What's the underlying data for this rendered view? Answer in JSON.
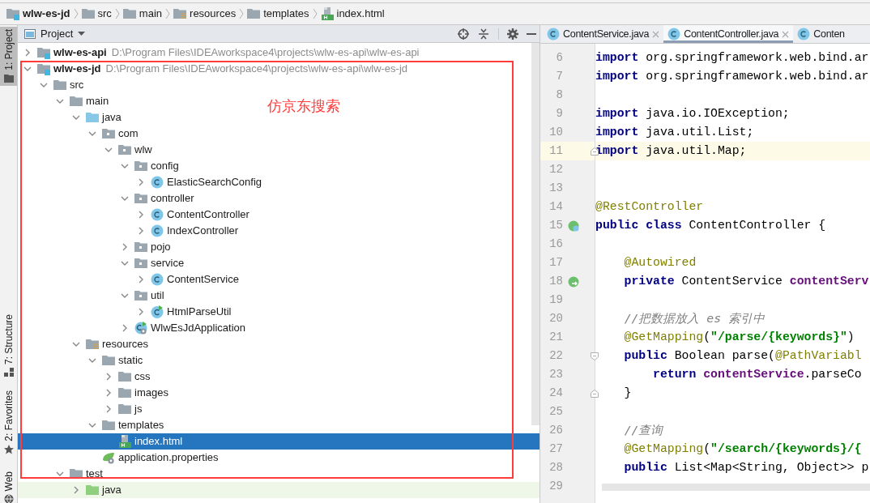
{
  "breadcrumb": [
    {
      "label": "wlw-es-jd",
      "kind": "module"
    },
    {
      "label": "src",
      "kind": "folder"
    },
    {
      "label": "main",
      "kind": "folder"
    },
    {
      "label": "resources",
      "kind": "resources"
    },
    {
      "label": "templates",
      "kind": "folder"
    },
    {
      "label": "index.html",
      "kind": "html"
    }
  ],
  "tool_strip": [
    {
      "label": "1: Project",
      "kind": "project",
      "selected": true
    },
    {
      "label": "7: Structure",
      "kind": "structure",
      "selected": false
    },
    {
      "label": "2: Favorites",
      "kind": "favorites",
      "selected": false
    },
    {
      "label": "Web",
      "kind": "web",
      "selected": false
    }
  ],
  "project_panel": {
    "title": "Project",
    "annotation": {
      "label": "仿京东搜索"
    },
    "tree": [
      {
        "label": "wlw-es-api",
        "kind": "module",
        "path": "D:\\Program Files\\IDEAworkspace4\\projects\\wlw-es-api\\wlw-es-api",
        "expanded": false,
        "selected": false
      },
      {
        "label": "wlw-es-jd",
        "kind": "module",
        "path": "D:\\Program Files\\IDEAworkspace4\\projects\\wlw-es-api\\wlw-es-jd",
        "expanded": true,
        "selected": false,
        "children": [
          {
            "label": "src",
            "kind": "folder",
            "expanded": true,
            "selected": false,
            "children": [
              {
                "label": "main",
                "kind": "folder",
                "expanded": true,
                "selected": false,
                "children": [
                  {
                    "label": "java",
                    "kind": "source-folder",
                    "expanded": true,
                    "selected": false,
                    "children": [
                      {
                        "label": "com",
                        "kind": "package",
                        "expanded": true,
                        "selected": false,
                        "children": [
                          {
                            "label": "wlw",
                            "kind": "package",
                            "expanded": true,
                            "selected": false,
                            "children": [
                              {
                                "label": "config",
                                "kind": "package",
                                "expanded": true,
                                "selected": false,
                                "children": [
                                  {
                                    "label": "ElasticSearchConfig",
                                    "kind": "class",
                                    "expanded": false,
                                    "selected": false
                                  }
                                ]
                              },
                              {
                                "label": "controller",
                                "kind": "package",
                                "expanded": true,
                                "selected": false,
                                "children": [
                                  {
                                    "label": "ContentController",
                                    "kind": "class",
                                    "expanded": false,
                                    "selected": false
                                  },
                                  {
                                    "label": "IndexController",
                                    "kind": "class",
                                    "expanded": false,
                                    "selected": false
                                  }
                                ]
                              },
                              {
                                "label": "pojo",
                                "kind": "package",
                                "expanded": false,
                                "selected": false
                              },
                              {
                                "label": "service",
                                "kind": "package",
                                "expanded": true,
                                "selected": false,
                                "children": [
                                  {
                                    "label": "ContentService",
                                    "kind": "class",
                                    "expanded": false,
                                    "selected": false
                                  }
                                ]
                              },
                              {
                                "label": "util",
                                "kind": "package",
                                "expanded": true,
                                "selected": false,
                                "children": [
                                  {
                                    "label": "HtmlParseUtil",
                                    "kind": "runnable-class",
                                    "expanded": false,
                                    "selected": false
                                  }
                                ]
                              },
                              {
                                "label": "WlwEsJdApplication",
                                "kind": "spring-class",
                                "expanded": false,
                                "selected": false
                              }
                            ]
                          }
                        ]
                      }
                    ]
                  },
                  {
                    "label": "resources",
                    "kind": "resources",
                    "expanded": true,
                    "selected": false,
                    "children": [
                      {
                        "label": "static",
                        "kind": "folder",
                        "expanded": true,
                        "selected": false,
                        "children": [
                          {
                            "label": "css",
                            "kind": "folder",
                            "expanded": false,
                            "selected": false
                          },
                          {
                            "label": "images",
                            "kind": "folder",
                            "expanded": false,
                            "selected": false
                          },
                          {
                            "label": "js",
                            "kind": "folder",
                            "expanded": false,
                            "selected": false
                          }
                        ]
                      },
                      {
                        "label": "templates",
                        "kind": "folder",
                        "expanded": true,
                        "selected": false,
                        "children": [
                          {
                            "label": "index.html",
                            "kind": "html",
                            "selected": true
                          }
                        ]
                      },
                      {
                        "label": "application.properties",
                        "kind": "properties",
                        "selected": false
                      }
                    ]
                  }
                ]
              },
              {
                "label": "test",
                "kind": "folder",
                "expanded": true,
                "selected": false,
                "children": [
                  {
                    "label": "java",
                    "kind": "test-source-folder",
                    "expanded": false,
                    "selected": false
                  }
                ]
              }
            ]
          }
        ]
      }
    ]
  },
  "editor": {
    "tabs": [
      {
        "label": "ContentService.java",
        "selected": false,
        "closable": true
      },
      {
        "label": "ContentController.java",
        "selected": true,
        "closable": true
      },
      {
        "label": "Conten",
        "selected": false,
        "closable": false
      }
    ],
    "lines": [
      {
        "number": "6",
        "tokens": [
          {
            "kind": "keyword",
            "text": "import"
          },
          {
            "kind": "plain",
            "text": " org.springframework.web.bind.ar"
          }
        ]
      },
      {
        "number": "7",
        "tokens": [
          {
            "kind": "keyword",
            "text": "import"
          },
          {
            "kind": "plain",
            "text": " org.springframework.web.bind.ar"
          }
        ]
      },
      {
        "number": "8"
      },
      {
        "number": "9",
        "tokens": [
          {
            "kind": "keyword",
            "text": "import"
          },
          {
            "kind": "plain",
            "text": " java.io.IOException;"
          }
        ]
      },
      {
        "number": "10",
        "tokens": [
          {
            "kind": "keyword",
            "text": "import"
          },
          {
            "kind": "plain",
            "text": " java.util.List;"
          }
        ]
      },
      {
        "number": "11",
        "highlighted": true,
        "fold": {
          "kind": "end"
        },
        "tokens": [
          {
            "kind": "keyword",
            "text": "import"
          },
          {
            "kind": "plain",
            "text": " java.util.Map;"
          }
        ]
      },
      {
        "number": "12"
      },
      {
        "number": "13"
      },
      {
        "number": "14",
        "tokens": [
          {
            "kind": "annotation",
            "text": "@RestController"
          }
        ]
      },
      {
        "number": "15",
        "marker": {
          "kind": "bean-class"
        },
        "tokens": [
          {
            "kind": "keyword",
            "text": "public class"
          },
          {
            "kind": "plain",
            "text": " ContentController {"
          }
        ]
      },
      {
        "number": "16"
      },
      {
        "number": "17",
        "tokens": [
          {
            "kind": "annotation",
            "text": "    @Autowired"
          }
        ]
      },
      {
        "number": "18",
        "marker": {
          "kind": "bean-link"
        },
        "tokens": [
          {
            "kind": "keyword",
            "text": "    private"
          },
          {
            "kind": "plain",
            "text": " ContentService "
          },
          {
            "kind": "field",
            "text": "contentServ"
          }
        ]
      },
      {
        "number": "19"
      },
      {
        "number": "20",
        "tokens": [
          {
            "kind": "comment",
            "text": "    //把数据放入 es 索引中"
          }
        ]
      },
      {
        "number": "21",
        "tokens": [
          {
            "kind": "annotation",
            "text": "    @GetMapping"
          },
          {
            "kind": "plain",
            "text": "("
          },
          {
            "kind": "string",
            "text": "\"/parse/{keywords}\""
          },
          {
            "kind": "plain",
            "text": ")"
          }
        ]
      },
      {
        "number": "22",
        "fold": {
          "kind": "start"
        },
        "tokens": [
          {
            "kind": "keyword",
            "text": "    public"
          },
          {
            "kind": "plain",
            "text": " Boolean parse("
          },
          {
            "kind": "annotation",
            "text": "@PathVariabl"
          }
        ]
      },
      {
        "number": "23",
        "tokens": [
          {
            "kind": "keyword",
            "text": "        return"
          },
          {
            "kind": "field",
            "text": " contentService"
          },
          {
            "kind": "plain",
            "text": ".parseCo"
          }
        ]
      },
      {
        "number": "24",
        "fold": {
          "kind": "end"
        },
        "tokens": [
          {
            "kind": "plain",
            "text": "    }"
          }
        ]
      },
      {
        "number": "25"
      },
      {
        "number": "26",
        "tokens": [
          {
            "kind": "comment",
            "text": "    //查询"
          }
        ]
      },
      {
        "number": "27",
        "tokens": [
          {
            "kind": "annotation",
            "text": "    @GetMapping"
          },
          {
            "kind": "plain",
            "text": "("
          },
          {
            "kind": "string",
            "text": "\"/search/{keywords}/{"
          }
        ]
      },
      {
        "number": "28",
        "tokens": [
          {
            "kind": "keyword",
            "text": "    public"
          },
          {
            "kind": "plain",
            "text": " List<Map<String, Object>> p"
          }
        ]
      },
      {
        "number": "29"
      }
    ]
  }
}
